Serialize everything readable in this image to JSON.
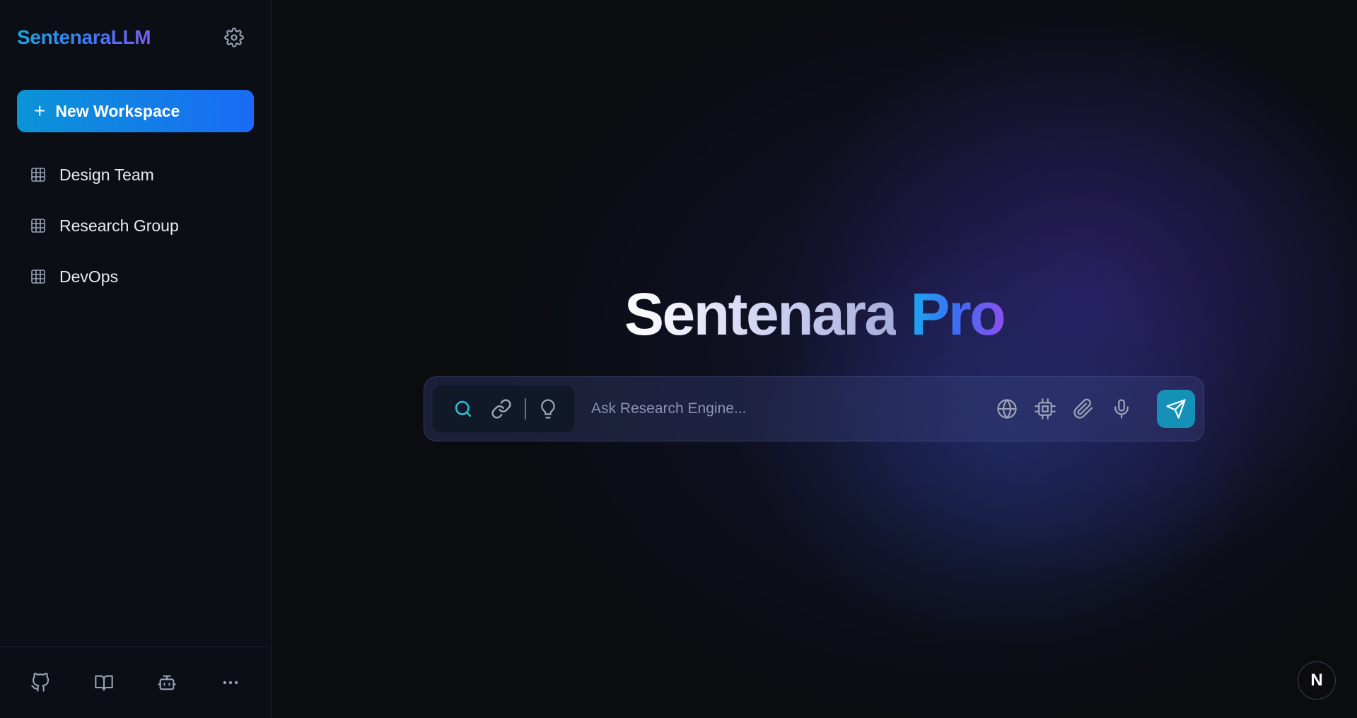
{
  "sidebar": {
    "brand": "SentenaraLLM",
    "settings_icon": "gear-icon",
    "new_workspace": {
      "icon": "plus-icon",
      "label": "New Workspace"
    },
    "workspaces": [
      {
        "label": "Design Team",
        "icon": "grid-icon"
      },
      {
        "label": "Research Group",
        "icon": "grid-icon"
      },
      {
        "label": "DevOps",
        "icon": "grid-icon"
      }
    ],
    "footer_icons": [
      "github-icon",
      "book-icon",
      "bot-icon",
      "more-icon"
    ]
  },
  "main": {
    "title_part1": "Sentenara",
    "title_part2": "Pro",
    "search": {
      "placeholder": "Ask Research Engine...",
      "mode_icons": [
        "search-icon",
        "link-icon",
        "lightbulb-icon"
      ],
      "tool_icons": [
        "globe-icon",
        "cpu-icon",
        "paperclip-icon",
        "microphone-icon"
      ],
      "send_icon": "send-icon"
    },
    "corner_badge": "N"
  },
  "colors": {
    "accent": "#1591b8",
    "brand_start": "#19a7e6",
    "brand_end": "#7c5cf3",
    "new_workspace_start": "#0a94d6",
    "new_workspace_end": "#1a6bf5",
    "mode_active": "#22c3d6"
  }
}
